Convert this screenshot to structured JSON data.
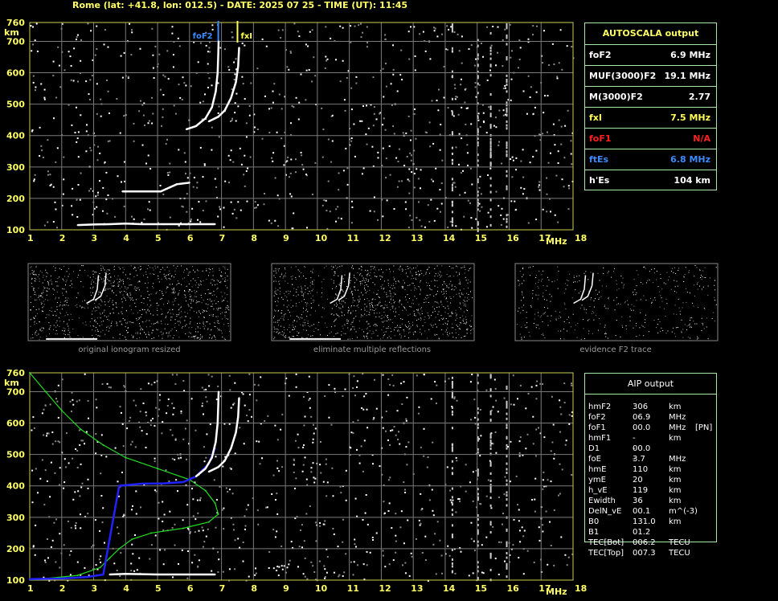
{
  "header": "Rome (lat: +41.8, lon: 012.5) - DATE: 2025 07 25 - TIME (UT): 11:45",
  "autoscala": {
    "title": "AUTOSCALA output",
    "rows": [
      {
        "label": "foF2",
        "value": "6.9 MHz",
        "color": "#ffffff"
      },
      {
        "label": "MUF(3000)F2",
        "value": "19.1 MHz",
        "color": "#ffffff"
      },
      {
        "label": "M(3000)F2",
        "value": "2.77",
        "color": "#ffffff"
      },
      {
        "label": "fxI",
        "value": "7.5 MHz",
        "color": "#ffff55"
      },
      {
        "label": "foF1",
        "value": "N/A",
        "color": "#ff2020"
      },
      {
        "label": "ftEs",
        "value": "6.8 MHz",
        "color": "#3b8bff"
      },
      {
        "label": "h'Es",
        "value": "104    km",
        "color": "#ffffff"
      }
    ]
  },
  "aip": {
    "title": "AIP output",
    "rows": [
      [
        "hmF2",
        "306",
        "km",
        ""
      ],
      [
        "foF2",
        "06.9",
        "MHz",
        ""
      ],
      [
        "foF1",
        "00.0",
        "MHz",
        "[PN]"
      ],
      [
        "hmF1",
        "---",
        "km",
        ""
      ],
      [
        "D1",
        "00.0",
        "",
        ""
      ],
      [
        "foE",
        "3.7",
        "MHz",
        ""
      ],
      [
        "hmE",
        "110",
        "km",
        ""
      ],
      [
        "ymE",
        "20",
        "km",
        ""
      ],
      [
        "h_vE",
        "119",
        "km",
        ""
      ],
      [
        "Ewidth",
        "36",
        "km",
        ""
      ],
      [
        "DelN_vE",
        "00.1",
        "m^(-3)",
        ""
      ],
      [
        "B0",
        "131.0",
        "km",
        ""
      ],
      [
        "B1",
        "01.2",
        "",
        ""
      ],
      [
        "TEC[Bot]",
        "006.2",
        "TECU",
        ""
      ],
      [
        "TEC[Top]",
        "007.3",
        "TECU",
        ""
      ]
    ]
  },
  "captions": [
    "original ionogram resized",
    "eliminate multiple reflections",
    "evidence F2 trace"
  ],
  "chart_data": [
    {
      "type": "scatter",
      "title": "",
      "xlabel": "MHz",
      "ylabel": "km",
      "xlim": [
        1,
        18
      ],
      "ylim": [
        100,
        760
      ],
      "xticks": [
        "1",
        "2",
        "3",
        "4",
        "5",
        "6",
        "7",
        "8",
        "9",
        "10",
        "11",
        "12",
        "13",
        "14",
        "15",
        "16",
        "17",
        "18"
      ],
      "yticks": [
        "100",
        "200",
        "300",
        "400",
        "500",
        "600",
        "700",
        "760"
      ],
      "grid": true,
      "markers": [
        {
          "name": "foF2",
          "x": 6.9,
          "color": "#3b8bff"
        },
        {
          "name": "fxI",
          "x": 7.5,
          "color": "#ffff55"
        }
      ],
      "series": [
        {
          "name": "",
          "color": "#ffffff",
          "points": [
            [
              5.9,
              420
            ],
            [
              6.2,
              430
            ],
            [
              6.5,
              455
            ],
            [
              6.7,
              490
            ],
            [
              6.82,
              540
            ],
            [
              6.88,
              600
            ],
            [
              6.9,
              660
            ],
            [
              6.91,
              700
            ]
          ]
        },
        {
          "name": "",
          "color": "#ffffff",
          "points": [
            [
              6.6,
              445
            ],
            [
              6.9,
              460
            ],
            [
              7.1,
              480
            ],
            [
              7.3,
              520
            ],
            [
              7.45,
              570
            ],
            [
              7.52,
              620
            ],
            [
              7.55,
              680
            ]
          ]
        },
        {
          "name": "",
          "color": "#ffffff",
          "points": [
            [
              2.5,
              115
            ],
            [
              3.0,
              117
            ],
            [
              3.5,
              118
            ],
            [
              4.0,
              120
            ],
            [
              4.5,
              118
            ],
            [
              5.0,
              118
            ],
            [
              5.5,
              118
            ],
            [
              6.0,
              118
            ],
            [
              6.5,
              118
            ],
            [
              6.8,
              118
            ]
          ]
        },
        {
          "name": "",
          "color": "#ffffff",
          "points": [
            [
              3.9,
              222
            ],
            [
              4.2,
              222
            ],
            [
              4.6,
              222
            ],
            [
              5.1,
              222
            ],
            [
              5.6,
              245
            ],
            [
              6.0,
              250
            ]
          ]
        }
      ]
    },
    {
      "type": "line",
      "title": "",
      "xlabel": "MHz",
      "ylabel": "km",
      "xlim": [
        1,
        18
      ],
      "ylim": [
        100,
        760
      ],
      "xticks": [
        "1",
        "2",
        "3",
        "4",
        "5",
        "6",
        "7",
        "8",
        "9",
        "10",
        "11",
        "12",
        "13",
        "14",
        "15",
        "16",
        "17",
        "18"
      ],
      "yticks": [
        "100",
        "200",
        "300",
        "400",
        "500",
        "600",
        "700",
        "760"
      ],
      "grid": true,
      "series": [
        {
          "name": "",
          "color": "#22dd22",
          "points": [
            [
              1.0,
              760
            ],
            [
              1.5,
              700
            ],
            [
              2.0,
              640
            ],
            [
              2.6,
              580
            ],
            [
              3.3,
              530
            ],
            [
              4.0,
              490
            ],
            [
              5.0,
              455
            ],
            [
              6.0,
              420
            ],
            [
              6.5,
              385
            ],
            [
              6.8,
              345
            ],
            [
              6.9,
              310
            ],
            [
              6.6,
              285
            ],
            [
              5.8,
              265
            ],
            [
              4.8,
              250
            ],
            [
              4.2,
              230
            ],
            [
              3.8,
              200
            ],
            [
              3.5,
              170
            ],
            [
              3.2,
              140
            ],
            [
              2.5,
              115
            ],
            [
              1.5,
              105
            ],
            [
              1.0,
              102
            ]
          ]
        },
        {
          "name": "",
          "color": "#2222ff",
          "points": [
            [
              1.0,
              103
            ],
            [
              2.0,
              105
            ],
            [
              2.8,
              110
            ],
            [
              3.3,
              118
            ],
            [
              3.8,
              400
            ],
            [
              4.5,
              407
            ],
            [
              5.2,
              408
            ],
            [
              5.8,
              412
            ],
            [
              6.2,
              430
            ],
            [
              6.6,
              470
            ],
            [
              6.8,
              520
            ]
          ]
        },
        {
          "name": "",
          "color": "#ffffff",
          "points": [
            [
              6.6,
              445
            ],
            [
              6.9,
              460
            ],
            [
              7.1,
              480
            ],
            [
              7.3,
              520
            ],
            [
              7.45,
              570
            ],
            [
              7.52,
              620
            ],
            [
              7.55,
              680
            ]
          ]
        },
        {
          "name": "",
          "color": "#ffffff",
          "points": [
            [
              6.2,
              430
            ],
            [
              6.5,
              455
            ],
            [
              6.7,
              490
            ],
            [
              6.82,
              540
            ],
            [
              6.88,
              600
            ],
            [
              6.9,
              660
            ],
            [
              6.91,
              700
            ]
          ]
        },
        {
          "name": "",
          "color": "#ffffff",
          "points": [
            [
              3.5,
              118
            ],
            [
              4.0,
              120
            ],
            [
              5.0,
              118
            ],
            [
              6.0,
              118
            ],
            [
              6.8,
              118
            ]
          ]
        }
      ]
    }
  ]
}
